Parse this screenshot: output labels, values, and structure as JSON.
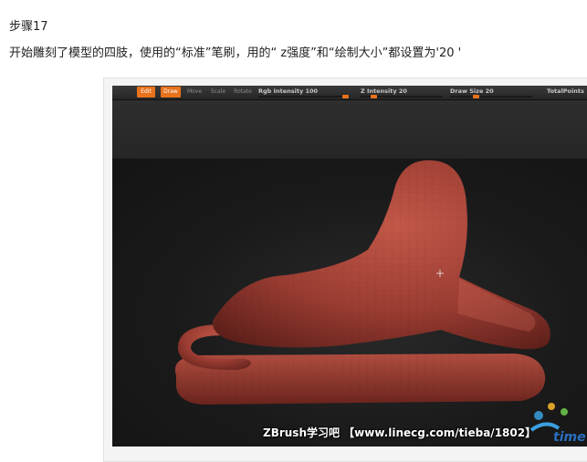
{
  "step": {
    "title": "步骤17",
    "description": "开始雕刻了模型的四肢，使用的“标准”笔刷，用的“ z强度”和“绘制大小”都设置为'20 '"
  },
  "zbrush_ui": {
    "buttons": [
      {
        "label": "Edit",
        "active": true
      },
      {
        "label": "Draw",
        "active": true
      },
      {
        "label": "Move",
        "active": false
      },
      {
        "label": "Scale",
        "active": false
      },
      {
        "label": "Rotate",
        "active": false
      }
    ],
    "rgb_intensity": {
      "label": "Rgb Intensity",
      "value": "100"
    },
    "z_intensity": {
      "label": "Z Intensity",
      "value": "20"
    },
    "draw_size": {
      "label": "Draw Size",
      "value": "20"
    },
    "total_points_label": "TotalPoints"
  },
  "watermark": {
    "caption": "ZBrush学习吧 【www.linecg.com/tieba/1802】",
    "logo_text": "time"
  },
  "colors": {
    "accent": "#e8721c",
    "sculpt": "#a8433a",
    "background": "#111111"
  }
}
